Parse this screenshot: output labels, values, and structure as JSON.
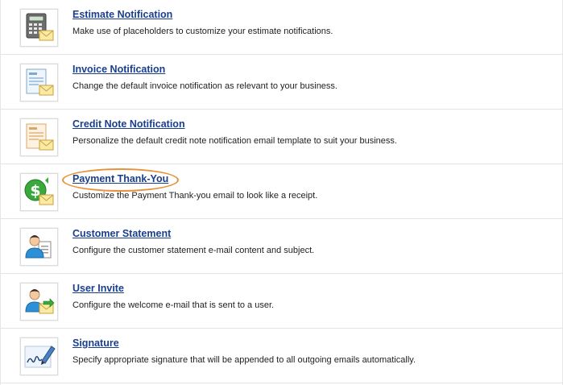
{
  "colors": {
    "link": "#1a3e8f",
    "highlight": "#e8923a"
  },
  "items": [
    {
      "title": "Estimate Notification",
      "description": "Make use of placeholders to customize your estimate notifications.",
      "icon": "calculator-mail-icon"
    },
    {
      "title": "Invoice Notification",
      "description": "Change the default invoice notification as relevant to your business.",
      "icon": "invoice-mail-icon"
    },
    {
      "title": "Credit Note Notification",
      "description": "Personalize the default credit note notification email template to suit your business.",
      "icon": "credit-note-mail-icon"
    },
    {
      "title": "Payment Thank-You",
      "description": "Customize the Payment Thank-you email to look like a receipt.",
      "icon": "dollar-mail-icon"
    },
    {
      "title": "Customer Statement",
      "description": "Configure the customer statement e-mail content and subject.",
      "icon": "user-document-icon"
    },
    {
      "title": "User Invite",
      "description": "Configure the welcome e-mail that is sent to a user.",
      "icon": "user-invite-mail-icon"
    },
    {
      "title": "Signature",
      "description": "Specify appropriate signature that will be appended to all outgoing emails automatically.",
      "icon": "signature-pen-icon"
    }
  ]
}
